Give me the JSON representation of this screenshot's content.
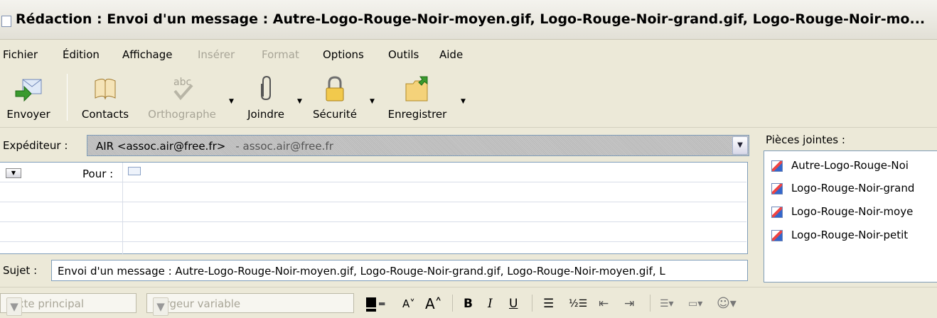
{
  "window": {
    "title": "Rédaction : Envoi d'un message : Autre-Logo-Rouge-Noir-moyen.gif, Logo-Rouge-Noir-grand.gif, Logo-Rouge-Noir-mo..."
  },
  "menu": [
    {
      "label": "Fichier",
      "enabled": true
    },
    {
      "label": "Édition",
      "enabled": true
    },
    {
      "label": "Affichage",
      "enabled": true
    },
    {
      "label": "Insérer",
      "enabled": false
    },
    {
      "label": "Format",
      "enabled": false
    },
    {
      "label": "Options",
      "enabled": true
    },
    {
      "label": "Outils",
      "enabled": true
    },
    {
      "label": "Aide",
      "enabled": true
    }
  ],
  "toolbar": {
    "send": "Envoyer",
    "contacts": "Contacts",
    "spelling": "Orthographe",
    "attach": "Joindre",
    "security": "Sécurité",
    "save": "Enregistrer"
  },
  "header": {
    "from_label": "Expéditeur :",
    "from_value": "AIR <assoc.air@free.fr>",
    "from_account": "- assoc.air@free.fr",
    "to_label": "Pour :",
    "subject_label": "Sujet :",
    "subject_value": "Envoi d'un message : Autre-Logo-Rouge-Noir-moyen.gif, Logo-Rouge-Noir-grand.gif, Logo-Rouge-Noir-moyen.gif, L"
  },
  "attachments": {
    "title": "Pièces jointes :",
    "items": [
      "Autre-Logo-Rouge-Noi",
      "Logo-Rouge-Noir-grand",
      "Logo-Rouge-Noir-moye",
      "Logo-Rouge-Noir-petit"
    ]
  },
  "format": {
    "paragraph": "Texte principal",
    "font": "Largeur variable",
    "text_color": "#000000"
  },
  "colors": {
    "chrome": "#ece9d8",
    "field_border": "#7f9db9",
    "disabled_text": "#a8a597"
  }
}
